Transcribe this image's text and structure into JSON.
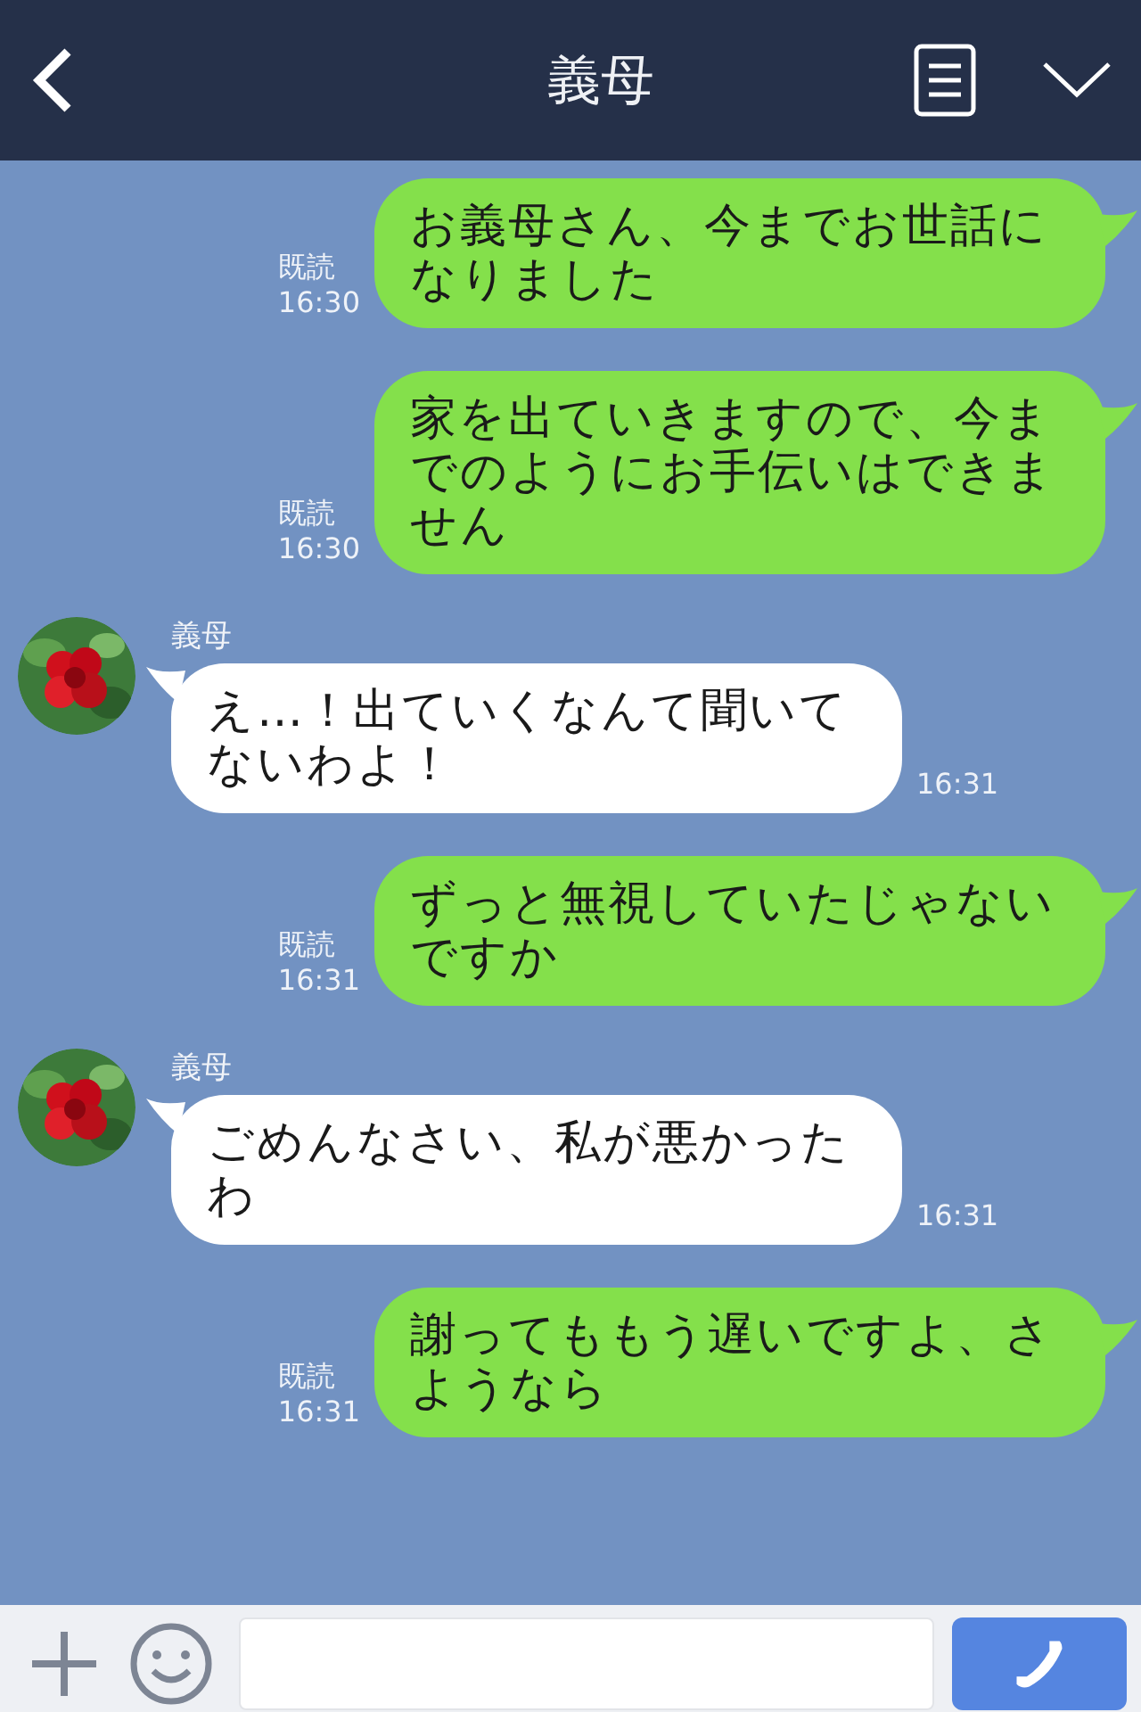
{
  "header": {
    "title": "義母"
  },
  "messages": [
    {
      "kind": "sent",
      "text": "お義母さん、今までお世話になりました",
      "read": "既読",
      "time": "16:30"
    },
    {
      "kind": "sent",
      "text": "家を出ていきますので、今までのようにお手伝いはできません",
      "read": "既読",
      "time": "16:30"
    },
    {
      "kind": "received",
      "sender": "義母",
      "text": "え…！出ていくなんて聞いてないわよ！",
      "time": "16:31"
    },
    {
      "kind": "sent",
      "text": "ずっと無視していたじゃないですか",
      "read": "既読",
      "time": "16:31"
    },
    {
      "kind": "received",
      "sender": "義母",
      "text": "ごめんなさい、私が悪かったわ",
      "time": "16:31"
    },
    {
      "kind": "sent",
      "text": "謝ってももう遅いですよ、さようなら",
      "read": "既読",
      "time": "16:31"
    }
  ]
}
